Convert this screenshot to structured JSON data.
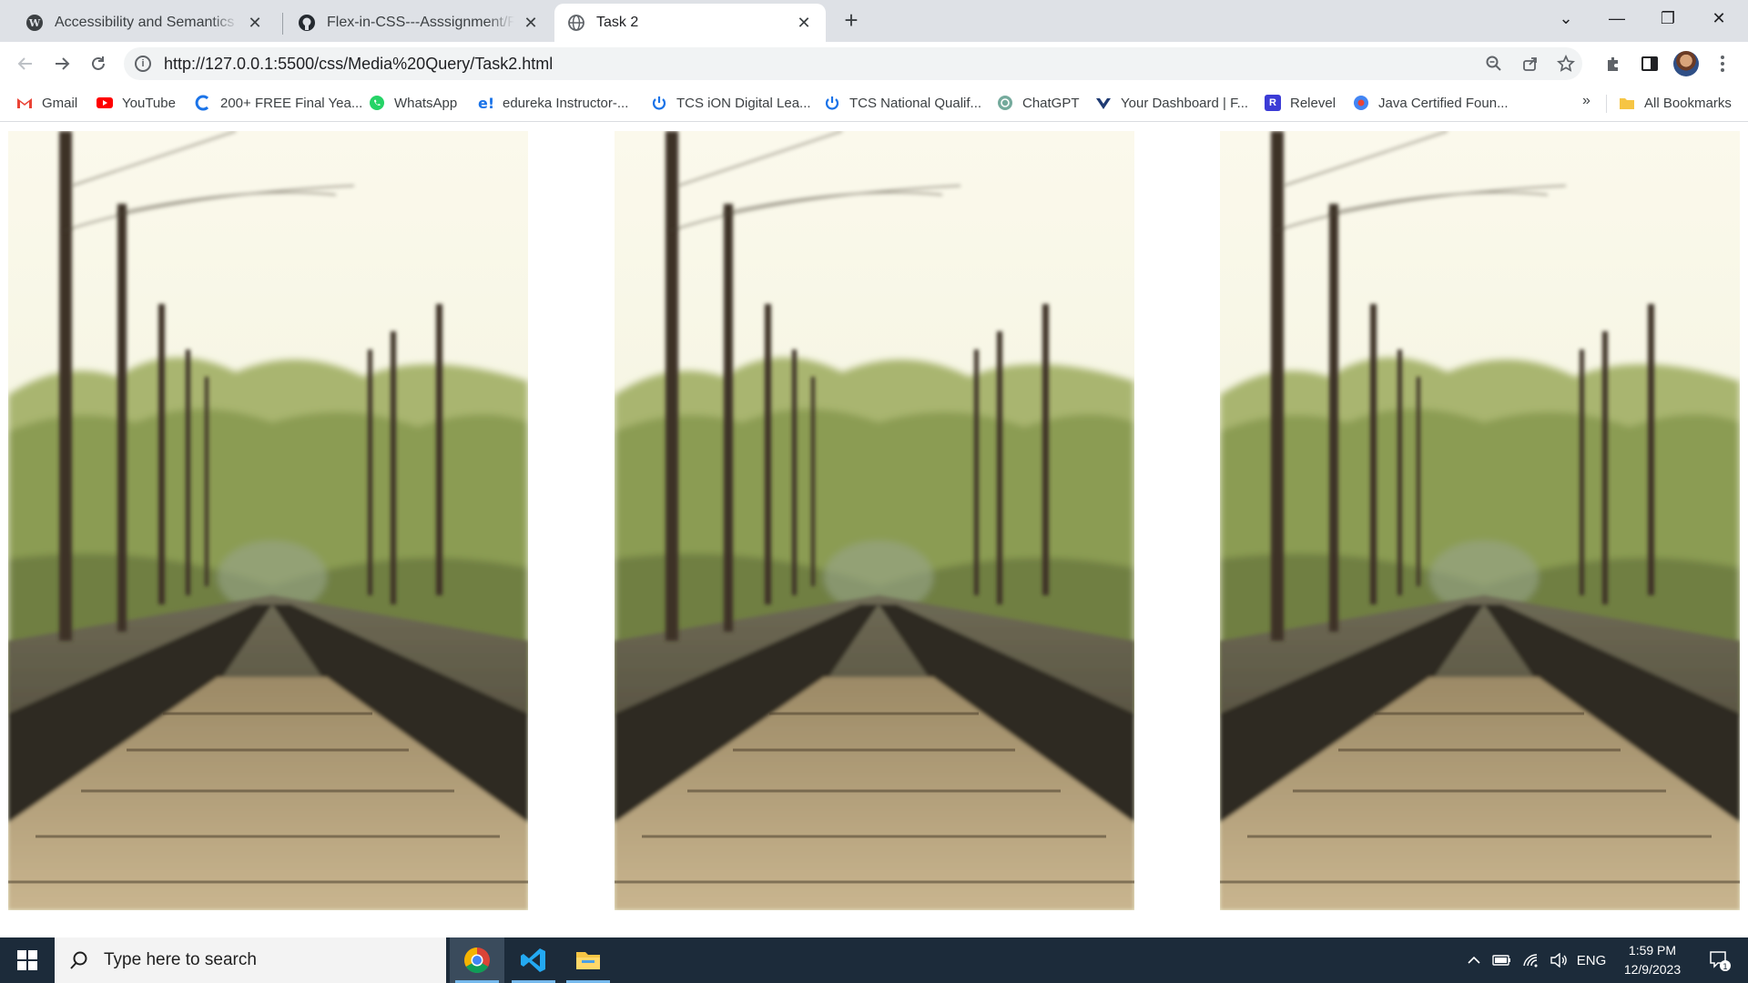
{
  "browser": {
    "tabs": [
      {
        "title": "Accessibility and Semantics - full",
        "favicon": "wordpress-icon",
        "active": false
      },
      {
        "title": "Flex-in-CSS---Asssignment/Flex/",
        "favicon": "github-icon",
        "active": false
      },
      {
        "title": "Task 2",
        "favicon": "globe-icon",
        "active": true
      }
    ],
    "tab_close_glyph": "✕",
    "new_tab_glyph": "+",
    "window_controls": {
      "tab_search": "⌄",
      "minimize": "—",
      "restore": "❐",
      "close": "✕"
    },
    "url": "http://127.0.0.1:5500/css/Media%20Query/Task2.html",
    "bookmarks": [
      {
        "label": "Gmail",
        "icon": "gmail-icon",
        "color": "#ea4335"
      },
      {
        "label": "YouTube",
        "icon": "youtube-icon",
        "color": "#ff0000"
      },
      {
        "label": "200+ FREE Final Yea...",
        "icon": "c-logo-icon",
        "color": "#1a73e8"
      },
      {
        "label": "WhatsApp",
        "icon": "whatsapp-icon",
        "color": "#25d366"
      },
      {
        "label": "edureka Instructor-...",
        "icon": "edureka-icon",
        "color": "#1a73e8"
      },
      {
        "label": "TCS iON Digital Lea...",
        "icon": "power-icon",
        "color": "#1a73e8"
      },
      {
        "label": "TCS National Qualif...",
        "icon": "power-icon",
        "color": "#1a73e8"
      },
      {
        "label": "ChatGPT",
        "icon": "chatgpt-icon",
        "color": "#74aa9c"
      },
      {
        "label": "Your Dashboard | F...",
        "icon": "dashboard-icon",
        "color": "#1f3b73"
      },
      {
        "label": "Relevel",
        "icon": "relevel-icon",
        "color": "#3b3bd6"
      },
      {
        "label": "Java Certified Foun...",
        "icon": "oracle-icon",
        "color": "#4285f4"
      }
    ],
    "bookmarks_more": "»",
    "all_bookmarks": "All Bookmarks"
  },
  "page": {
    "images": [
      {
        "alt": "railway track photo",
        "name": "railway-image-1"
      },
      {
        "alt": "railway track photo",
        "name": "railway-image-2"
      },
      {
        "alt": "railway track photo",
        "name": "railway-image-3"
      }
    ]
  },
  "taskbar": {
    "search_placeholder": "Type here to search",
    "apps": [
      "chrome-icon",
      "vscode-icon",
      "file-explorer-icon"
    ],
    "language": "ENG",
    "time": "1:59 PM",
    "date": "12/9/2023",
    "notification_count": "1"
  },
  "colors": {
    "taskbar_bg": "#1c2b3a",
    "tabstrip_bg": "#dee1e6",
    "accent": "#1a73e8"
  }
}
